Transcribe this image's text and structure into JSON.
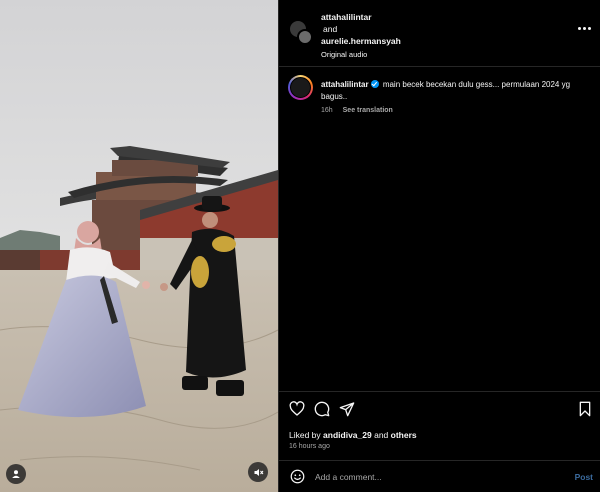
{
  "header": {
    "username_1": "attahalilintar",
    "conjunction": "and",
    "username_2": "aurelie.hermansyah",
    "audio": "Original audio"
  },
  "caption": {
    "username": "attahalilintar",
    "text": "main becek becekan dulu gess... permulaan 2024 yg bagus..",
    "time": "16h",
    "translate": "See translation"
  },
  "actions": {
    "liked_by_prefix": "Liked by",
    "liked_by_user": "andidiva_29",
    "liked_by_and": "and",
    "liked_by_others": "others",
    "timestamp": "16 hours ago"
  },
  "comment": {
    "placeholder": "Add a comment...",
    "post_label": "Post"
  },
  "icons": {
    "more": "more-options-icon",
    "like": "heart-icon",
    "comment": "comment-icon",
    "share": "share-icon",
    "save": "bookmark-icon",
    "emoji": "emoji-icon",
    "tag": "user-tag-icon",
    "mute": "muted-audio-icon"
  },
  "colors": {
    "background": "#000000",
    "text": "#f5f5f5",
    "secondary_text": "#a8a8a8",
    "divider": "#262626",
    "verified": "#0095f6",
    "post_disabled": "#3b6b9e"
  }
}
